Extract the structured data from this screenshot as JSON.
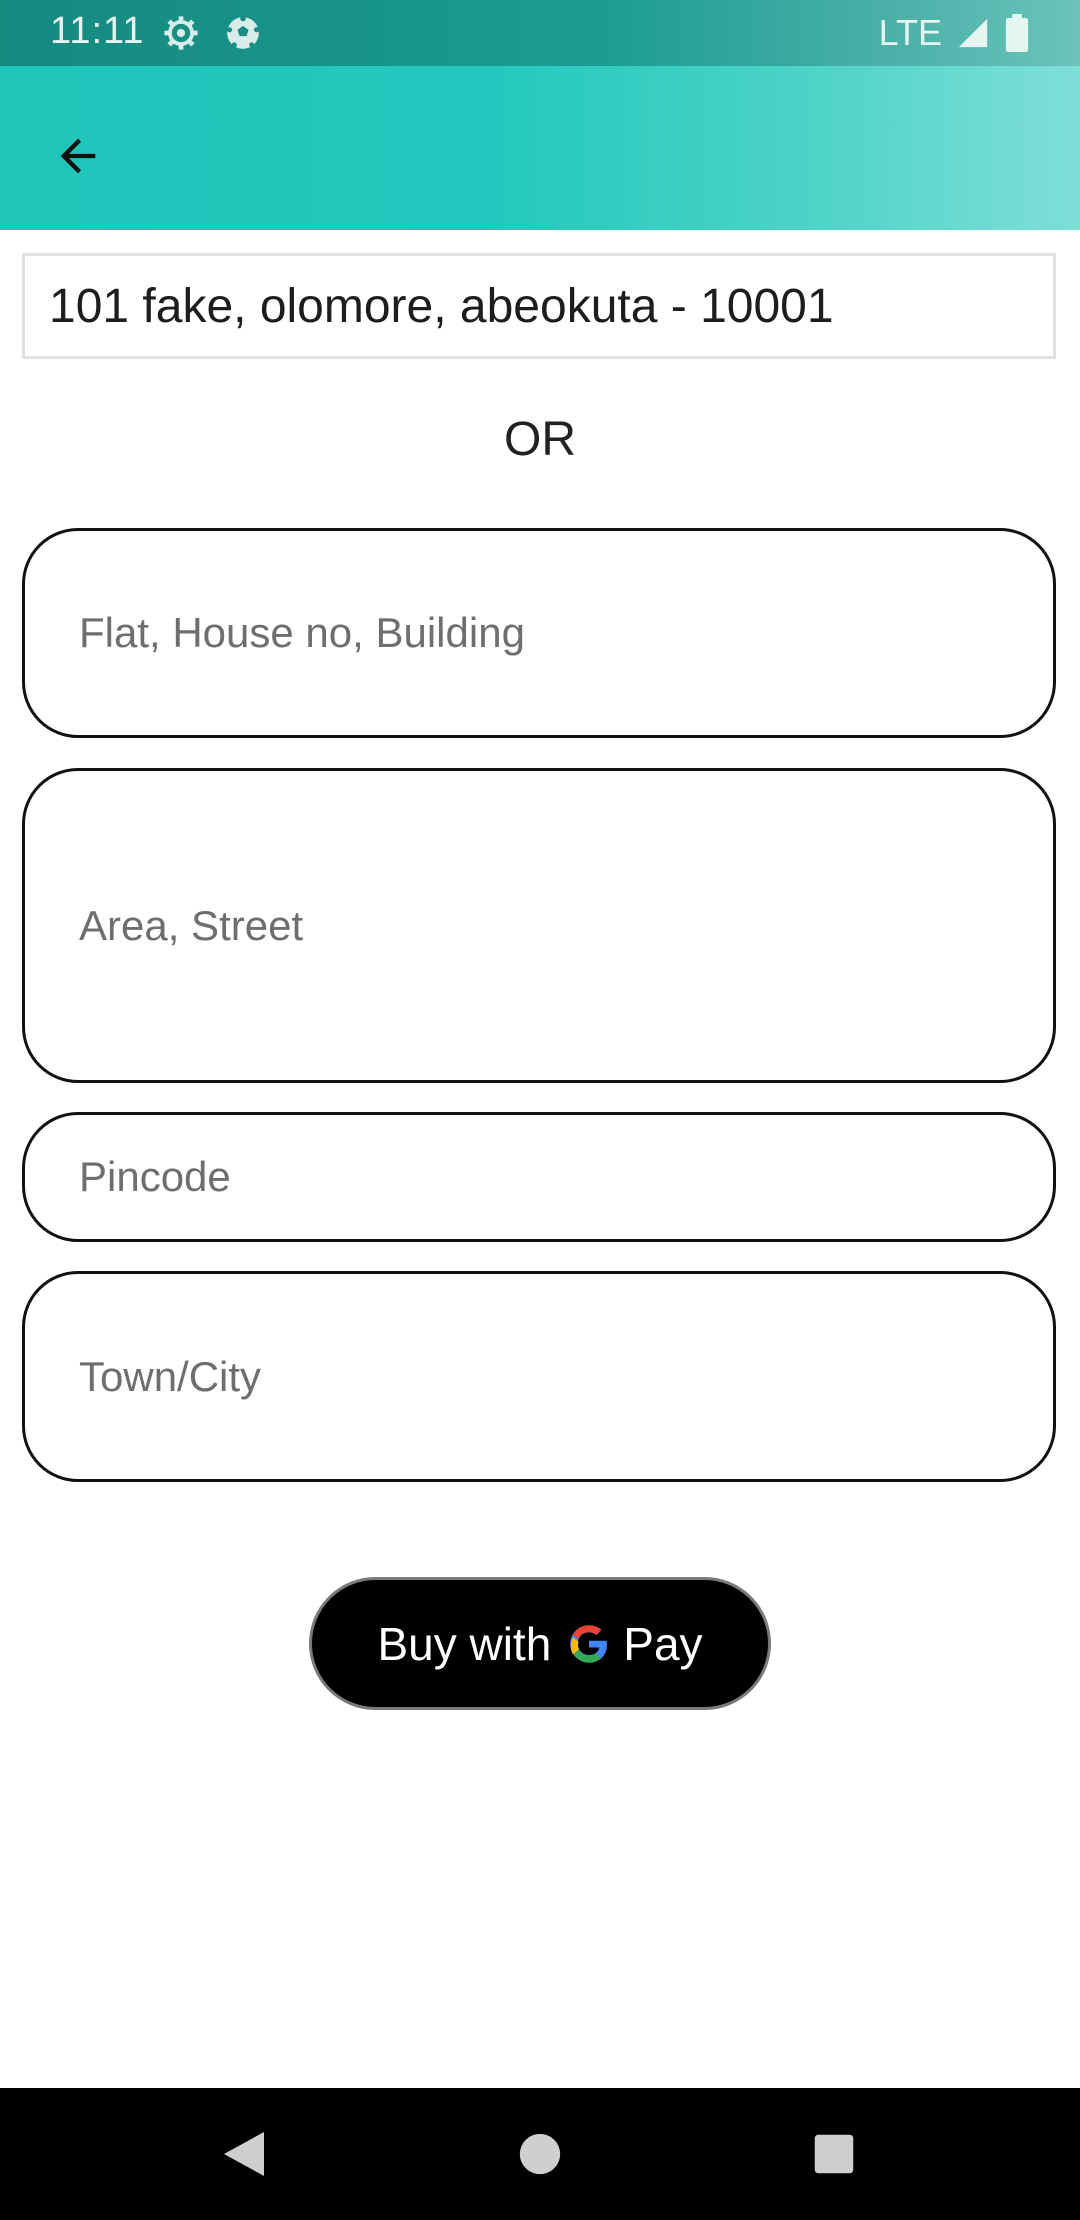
{
  "status_bar": {
    "time": "11:11",
    "network": "LTE",
    "icons": [
      "settings-icon",
      "soccer-ball-icon",
      "signal-icon",
      "battery-icon"
    ]
  },
  "app_bar": {
    "back_icon": "arrow-left-icon"
  },
  "address": {
    "selected_value": "101 fake, olomore, abeokuta - 10001"
  },
  "separator": "OR",
  "form": {
    "flat_placeholder": "Flat, House no, Building",
    "area_placeholder": "Area, Street",
    "pincode_placeholder": "Pincode",
    "city_placeholder": "Town/City"
  },
  "gpay_button": {
    "label_prefix": "Buy with",
    "label_suffix": "Pay",
    "logo_icon": "google-g-icon"
  },
  "nav": {
    "icons": [
      "back-triangle-icon",
      "home-circle-icon",
      "recents-square-icon"
    ]
  },
  "colors": {
    "app_bar": "#22c8bd",
    "status_bar": "#1a9c92",
    "field_border": "#111111",
    "button_bg": "#000000"
  }
}
